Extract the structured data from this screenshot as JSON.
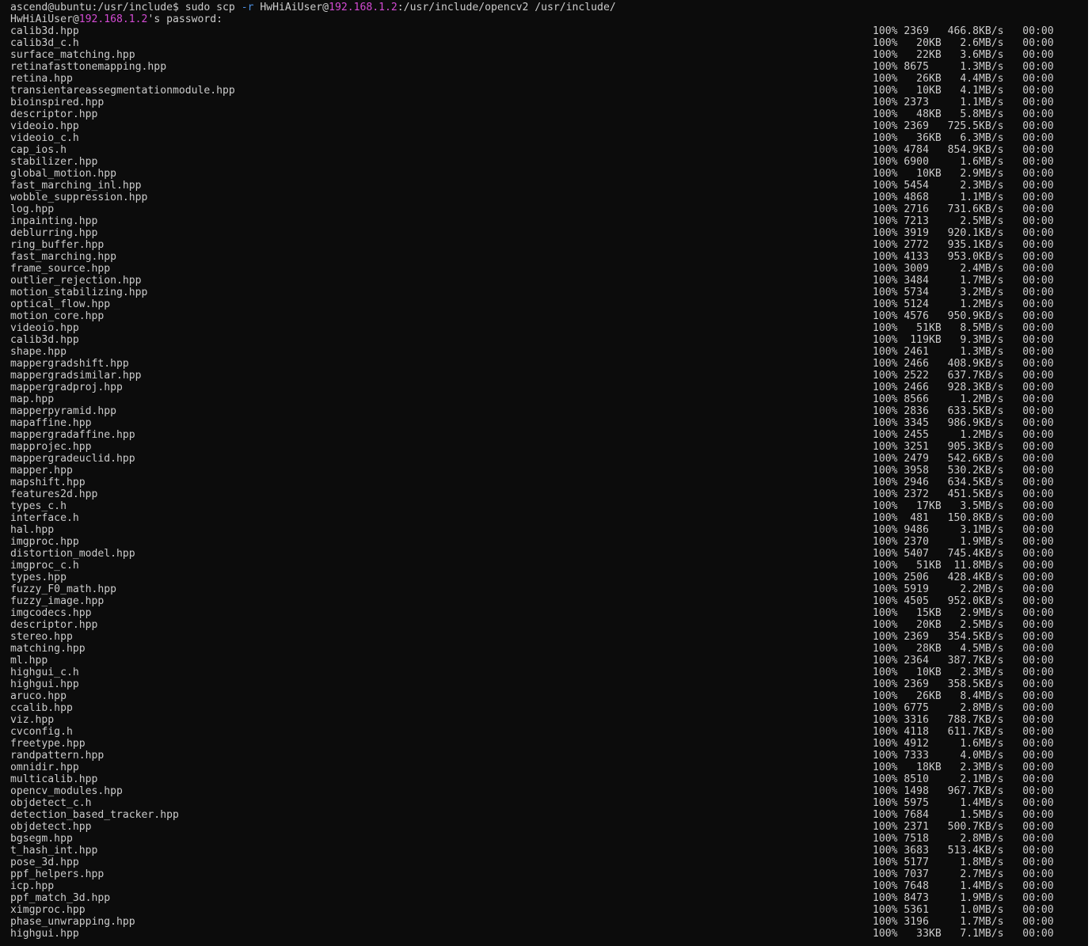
{
  "prompt": {
    "user_host": "ascend@ubuntu",
    "path": ":/usr/include$ ",
    "cmd_start": "sudo scp ",
    "flag": "-r",
    "cmd_user": " HwHiAiUser@",
    "ip": "192.168.1.2",
    "cmd_rest": ":/usr/include/opencv2 /usr/include/"
  },
  "password_line": {
    "user": "HwHiAiUser@",
    "ip": "192.168.1.2",
    "rest": "'s password:"
  },
  "files": [
    {
      "name": "calib3d.hpp",
      "stats": "100% 2369   466.8KB/s   00:00"
    },
    {
      "name": "calib3d_c.h",
      "stats": "100%   20KB   2.6MB/s   00:00"
    },
    {
      "name": "surface_matching.hpp",
      "stats": "100%   22KB   3.6MB/s   00:00"
    },
    {
      "name": "retinafasttonemapping.hpp",
      "stats": "100% 8675     1.3MB/s   00:00"
    },
    {
      "name": "retina.hpp",
      "stats": "100%   26KB   4.4MB/s   00:00"
    },
    {
      "name": "transientareassegmentationmodule.hpp",
      "stats": "100%   10KB   4.1MB/s   00:00"
    },
    {
      "name": "bioinspired.hpp",
      "stats": "100% 2373     1.1MB/s   00:00"
    },
    {
      "name": "descriptor.hpp",
      "stats": "100%   48KB   5.8MB/s   00:00"
    },
    {
      "name": "videoio.hpp",
      "stats": "100% 2369   725.5KB/s   00:00"
    },
    {
      "name": "videoio_c.h",
      "stats": "100%   36KB   6.3MB/s   00:00"
    },
    {
      "name": "cap_ios.h",
      "stats": "100% 4784   854.9KB/s   00:00"
    },
    {
      "name": "stabilizer.hpp",
      "stats": "100% 6900     1.6MB/s   00:00"
    },
    {
      "name": "global_motion.hpp",
      "stats": "100%   10KB   2.9MB/s   00:00"
    },
    {
      "name": "fast_marching_inl.hpp",
      "stats": "100% 5454     2.3MB/s   00:00"
    },
    {
      "name": "wobble_suppression.hpp",
      "stats": "100% 4868     1.1MB/s   00:00"
    },
    {
      "name": "log.hpp",
      "stats": "100% 2716   731.6KB/s   00:00"
    },
    {
      "name": "inpainting.hpp",
      "stats": "100% 7213     2.5MB/s   00:00"
    },
    {
      "name": "deblurring.hpp",
      "stats": "100% 3919   920.1KB/s   00:00"
    },
    {
      "name": "ring_buffer.hpp",
      "stats": "100% 2772   935.1KB/s   00:00"
    },
    {
      "name": "fast_marching.hpp",
      "stats": "100% 4133   953.0KB/s   00:00"
    },
    {
      "name": "frame_source.hpp",
      "stats": "100% 3009     2.4MB/s   00:00"
    },
    {
      "name": "outlier_rejection.hpp",
      "stats": "100% 3484     1.7MB/s   00:00"
    },
    {
      "name": "motion_stabilizing.hpp",
      "stats": "100% 5734     3.2MB/s   00:00"
    },
    {
      "name": "optical_flow.hpp",
      "stats": "100% 5124     1.2MB/s   00:00"
    },
    {
      "name": "motion_core.hpp",
      "stats": "100% 4576   950.9KB/s   00:00"
    },
    {
      "name": "videoio.hpp",
      "stats": "100%   51KB   8.5MB/s   00:00"
    },
    {
      "name": "calib3d.hpp",
      "stats": "100%  119KB   9.3MB/s   00:00"
    },
    {
      "name": "shape.hpp",
      "stats": "100% 2461     1.3MB/s   00:00"
    },
    {
      "name": "mappergradshift.hpp",
      "stats": "100% 2466   408.9KB/s   00:00"
    },
    {
      "name": "mappergradsimilar.hpp",
      "stats": "100% 2522   637.7KB/s   00:00"
    },
    {
      "name": "mappergradproj.hpp",
      "stats": "100% 2466   928.3KB/s   00:00"
    },
    {
      "name": "map.hpp",
      "stats": "100% 8566     1.2MB/s   00:00"
    },
    {
      "name": "mapperpyramid.hpp",
      "stats": "100% 2836   633.5KB/s   00:00"
    },
    {
      "name": "mapaffine.hpp",
      "stats": "100% 3345   986.9KB/s   00:00"
    },
    {
      "name": "mappergradaffine.hpp",
      "stats": "100% 2455     1.2MB/s   00:00"
    },
    {
      "name": "mapprojec.hpp",
      "stats": "100% 3251   905.3KB/s   00:00"
    },
    {
      "name": "mappergradeuclid.hpp",
      "stats": "100% 2479   542.6KB/s   00:00"
    },
    {
      "name": "mapper.hpp",
      "stats": "100% 3958   530.2KB/s   00:00"
    },
    {
      "name": "mapshift.hpp",
      "stats": "100% 2946   634.5KB/s   00:00"
    },
    {
      "name": "features2d.hpp",
      "stats": "100% 2372   451.5KB/s   00:00"
    },
    {
      "name": "types_c.h",
      "stats": "100%   17KB   3.5MB/s   00:00"
    },
    {
      "name": "interface.h",
      "stats": "100%  481   150.8KB/s   00:00"
    },
    {
      "name": "hal.hpp",
      "stats": "100% 9486     3.1MB/s   00:00"
    },
    {
      "name": "imgproc.hpp",
      "stats": "100% 2370     1.9MB/s   00:00"
    },
    {
      "name": "distortion_model.hpp",
      "stats": "100% 5407   745.4KB/s   00:00"
    },
    {
      "name": "imgproc_c.h",
      "stats": "100%   51KB  11.8MB/s   00:00"
    },
    {
      "name": "types.hpp",
      "stats": "100% 2506   428.4KB/s   00:00"
    },
    {
      "name": "fuzzy_F0_math.hpp",
      "stats": "100% 5919     2.2MB/s   00:00"
    },
    {
      "name": "fuzzy_image.hpp",
      "stats": "100% 4505   952.0KB/s   00:00"
    },
    {
      "name": "imgcodecs.hpp",
      "stats": "100%   15KB   2.9MB/s   00:00"
    },
    {
      "name": "descriptor.hpp",
      "stats": "100%   20KB   2.5MB/s   00:00"
    },
    {
      "name": "stereo.hpp",
      "stats": "100% 2369   354.5KB/s   00:00"
    },
    {
      "name": "matching.hpp",
      "stats": "100%   28KB   4.5MB/s   00:00"
    },
    {
      "name": "ml.hpp",
      "stats": "100% 2364   387.7KB/s   00:00"
    },
    {
      "name": "highgui_c.h",
      "stats": "100%   10KB   2.3MB/s   00:00"
    },
    {
      "name": "highgui.hpp",
      "stats": "100% 2369   358.5KB/s   00:00"
    },
    {
      "name": "aruco.hpp",
      "stats": "100%   26KB   8.4MB/s   00:00"
    },
    {
      "name": "ccalib.hpp",
      "stats": "100% 6775     2.8MB/s   00:00"
    },
    {
      "name": "viz.hpp",
      "stats": "100% 3316   788.7KB/s   00:00"
    },
    {
      "name": "cvconfig.h",
      "stats": "100% 4118   611.7KB/s   00:00"
    },
    {
      "name": "freetype.hpp",
      "stats": "100% 4912     1.6MB/s   00:00"
    },
    {
      "name": "randpattern.hpp",
      "stats": "100% 7333     4.0MB/s   00:00"
    },
    {
      "name": "omnidir.hpp",
      "stats": "100%   18KB   2.3MB/s   00:00"
    },
    {
      "name": "multicalib.hpp",
      "stats": "100% 8510     2.1MB/s   00:00"
    },
    {
      "name": "opencv_modules.hpp",
      "stats": "100% 1498   967.7KB/s   00:00"
    },
    {
      "name": "objdetect_c.h",
      "stats": "100% 5975     1.4MB/s   00:00"
    },
    {
      "name": "detection_based_tracker.hpp",
      "stats": "100% 7684     1.5MB/s   00:00"
    },
    {
      "name": "objdetect.hpp",
      "stats": "100% 2371   500.7KB/s   00:00"
    },
    {
      "name": "bgsegm.hpp",
      "stats": "100% 7518     2.8MB/s   00:00"
    },
    {
      "name": "t_hash_int.hpp",
      "stats": "100% 3683   513.4KB/s   00:00"
    },
    {
      "name": "pose_3d.hpp",
      "stats": "100% 5177     1.8MB/s   00:00"
    },
    {
      "name": "ppf_helpers.hpp",
      "stats": "100% 7037     2.7MB/s   00:00"
    },
    {
      "name": "icp.hpp",
      "stats": "100% 7648     1.4MB/s   00:00"
    },
    {
      "name": "ppf_match_3d.hpp",
      "stats": "100% 8473     1.9MB/s   00:00"
    },
    {
      "name": "ximgproc.hpp",
      "stats": "100% 5361     1.0MB/s   00:00"
    },
    {
      "name": "phase_unwrapping.hpp",
      "stats": "100% 3196     1.7MB/s   00:00"
    },
    {
      "name": "highgui.hpp",
      "stats": "100%   33KB   7.1MB/s   00:00"
    }
  ],
  "colors": {
    "background": "#0c0c0c",
    "foreground": "#cccccc",
    "highlight": "#d34bd3",
    "flag": "#4c8fe0"
  }
}
